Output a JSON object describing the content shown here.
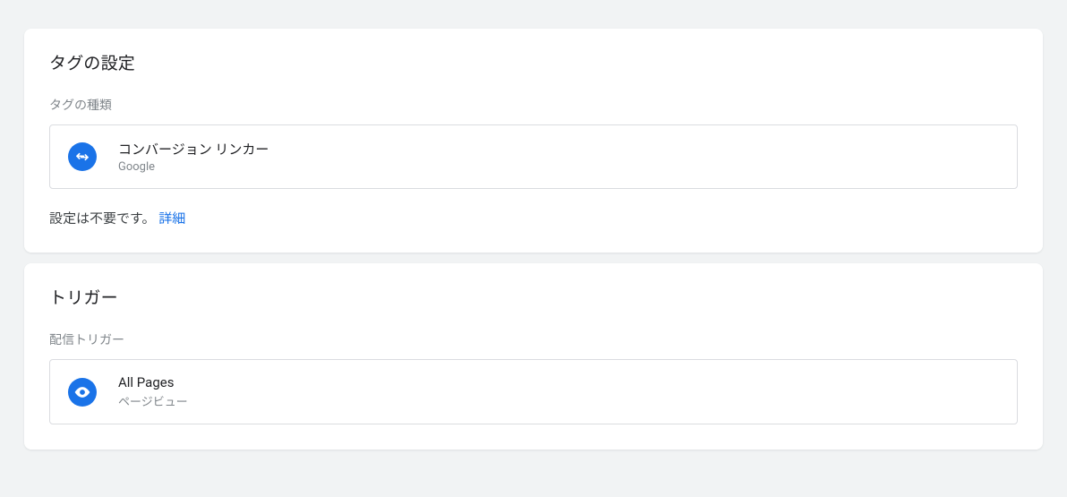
{
  "tag_config": {
    "title": "タグの設定",
    "type_label": "タグの種類",
    "tag_type": {
      "name": "コンバージョン リンカー",
      "vendor": "Google"
    },
    "note_text": "設定は不要です。",
    "note_link": "詳細"
  },
  "trigger": {
    "title": "トリガー",
    "section_label": "配信トリガー",
    "item": {
      "name": "All Pages",
      "type": "ページビュー"
    }
  }
}
